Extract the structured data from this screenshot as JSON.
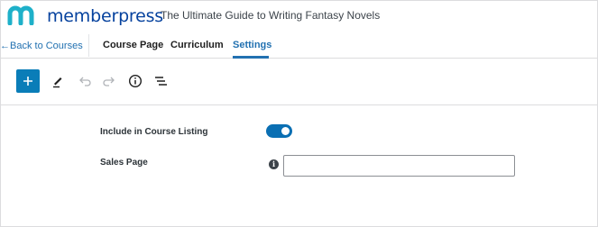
{
  "header": {
    "brand": "memberpress",
    "course_title": "The Ultimate Guide to Writing Fantasy Novels"
  },
  "nav": {
    "back_label": "←Back to Courses",
    "tabs": [
      {
        "label": "Course Page",
        "active": false
      },
      {
        "label": "Curriculum",
        "active": false
      },
      {
        "label": "Settings",
        "active": true
      }
    ]
  },
  "toolbar": {
    "icons": [
      "plus-icon",
      "pencil-icon",
      "undo-icon",
      "redo-icon",
      "info-icon",
      "list-view-icon"
    ]
  },
  "settings": {
    "include_listing_label": "Include in Course Listing",
    "include_listing_enabled": true,
    "sales_page_label": "Sales Page",
    "sales_page_value": ""
  },
  "colors": {
    "accent": "#2271b1",
    "brand": "#06429e",
    "logo": "#1eb0c9",
    "add_button": "#0a7db8",
    "toggle_on": "#0a6fb3"
  }
}
